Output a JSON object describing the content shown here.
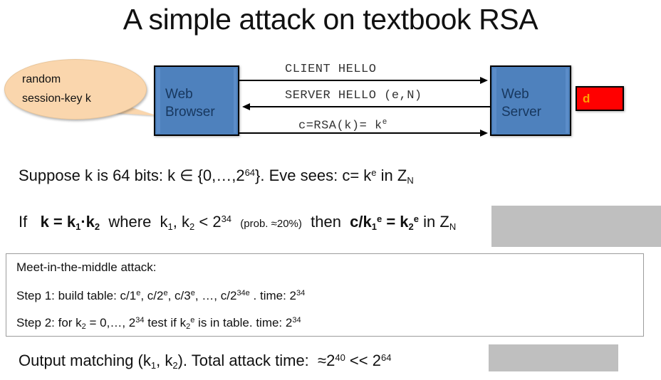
{
  "slide": {
    "title": "A simple attack on textbook RSA"
  },
  "diagram": {
    "callout": {
      "line1": "random",
      "line2": "session-key k"
    },
    "browser": {
      "line1": "Web",
      "line2": "Browser"
    },
    "server": {
      "line1": "Web",
      "line2": "Server"
    },
    "private_key_label": "d",
    "private_key_box_color": "#FF0000",
    "node_box_color": "#4E81BD",
    "callout_color": "#FAD6AD",
    "messages": [
      {
        "text": "CLIENT HELLO",
        "direction": "right"
      },
      {
        "text": "SERVER HELLO (e,N)",
        "direction": "left"
      },
      {
        "text_prefix": "c=RSA(k)=  k",
        "text_sup": "e",
        "direction": "right"
      }
    ]
  },
  "body": {
    "suppose": {
      "p1": "Suppose  k  is 64 bits:   k ∈ {0,…,2",
      "sup1": "64",
      "p2": "}.     Eve sees:    c= k",
      "sup2": "e",
      "p3": "  in  Z",
      "sub1": "N"
    },
    "ifline": {
      "p1": "If",
      "bold1": "k = k",
      "bold1sub": "1",
      "bold1b": "·k",
      "bold1sub2": "2",
      "p2": "where",
      "p3": "k",
      "sub1": "1",
      "p4": ", k",
      "sub2": "2",
      "p5": " < 2",
      "sup1": "34",
      "note": "(prob. ≈20%)",
      "p6": "then",
      "hl_bold1": "c/k",
      "hl_sub1": "1",
      "hl_sup1": "e",
      "hl_bold2": " = k",
      "hl_sub2": "2",
      "hl_sup2": "e",
      "hl_p1": "  in  Z",
      "hl_sub3": "N"
    },
    "output": {
      "p1": "Output matching  (k",
      "sub1": "1",
      "p2": ", k",
      "sub2": "2",
      "p3": ").          Total attack time:",
      "hl_p1": "≈2",
      "hl_sup1": "40",
      "hl_p2": " << 2",
      "hl_sup2": "64"
    }
  },
  "attack_box": {
    "title": "Meet-in-the-middle attack:",
    "step1": {
      "p1": "Step 1:   build table:   c/1",
      "sup1": "e",
      "p2": ", c/2",
      "sup2": "e",
      "p3": ", c/3",
      "sup3": "e",
      "p4": ", …, c/2",
      "sup4": "34e",
      "p5": " .   time:  2",
      "sup5": "34"
    },
    "step2": {
      "p1": "Step 2:   for  k",
      "sub1": "2",
      "p2": " = 0,…, 2",
      "sup1": "34",
      "p3": "  test if  k",
      "sub2": "2",
      "sup2": "e",
      "p4": "  is in table.   time: 2",
      "sup3": "34"
    }
  }
}
